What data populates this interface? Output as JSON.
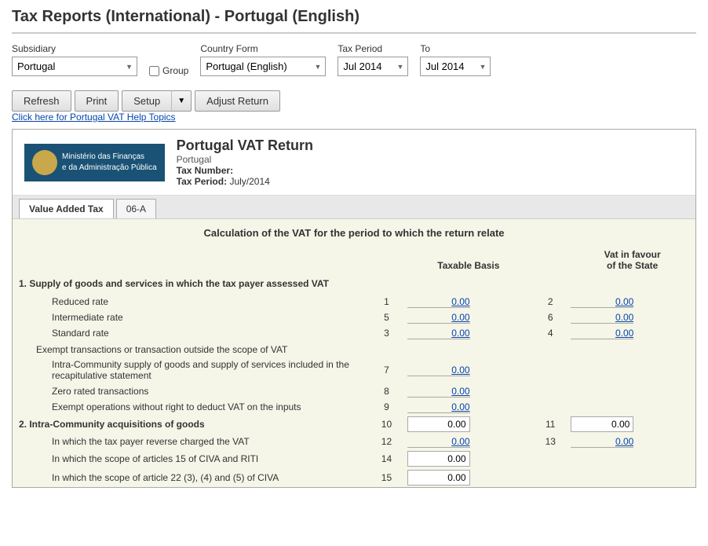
{
  "page": {
    "title": "Tax Reports (International) - Portugal (English)"
  },
  "toolbar": {
    "subsidiary_label": "Subsidiary",
    "subsidiary_value": "Portugal",
    "group_label": "Group",
    "country_form_label": "Country Form",
    "country_form_value": "Portugal (English)",
    "tax_period_label": "Tax Period",
    "tax_period_value": "Jul 2014",
    "to_label": "To",
    "to_value": "Jul 2014",
    "refresh_label": "Refresh",
    "print_label": "Print",
    "setup_label": "Setup",
    "setup_arrow": "▼",
    "adjust_return_label": "Adjust Return"
  },
  "help_link": "Click here for Portugal VAT Help Topics",
  "report": {
    "ministry_line1": "Ministério das Finanças",
    "ministry_line2": "e da Administração Pública",
    "vat_title": "Portugal VAT Return",
    "subtitle": "Portugal",
    "tax_number_label": "Tax Number:",
    "tax_period_label": "Tax Period:",
    "tax_period_value": "July/2014"
  },
  "tabs": [
    {
      "label": "Value Added Tax",
      "active": true
    },
    {
      "label": "06-A",
      "active": false
    }
  ],
  "section": {
    "heading": "Calculation of the VAT for the period to which the return relate",
    "col_taxable_basis": "Taxable Basis",
    "col_vat_favour": "Vat in favour",
    "col_vat_favour2": "of the State",
    "rows": [
      {
        "type": "section-header",
        "label": "1.  Supply of goods and services in which the tax payer assessed VAT",
        "label_bold": true,
        "vat_label": true
      },
      {
        "type": "data-row",
        "label": "Reduced rate",
        "indent": "indent2",
        "num1": "1",
        "val1": "0.00",
        "val1_link": true,
        "num2": "2",
        "val2": "0.00",
        "val2_link": true
      },
      {
        "type": "data-row",
        "label": "Intermediate rate",
        "indent": "indent2",
        "num1": "5",
        "val1": "0.00",
        "val1_link": true,
        "num2": "6",
        "val2": "0.00",
        "val2_link": true
      },
      {
        "type": "data-row",
        "label": "Standard rate",
        "indent": "indent2",
        "num1": "3",
        "val1": "0.00",
        "val1_link": true,
        "num2": "4",
        "val2": "0.00",
        "val2_link": true
      },
      {
        "type": "sub-header",
        "label": "Exempt transactions or transaction outside the scope of VAT",
        "indent": "indent"
      },
      {
        "type": "data-row",
        "label": "Intra-Community supply of goods and supply of services included in the recapitulative statement",
        "indent": "indent2",
        "num1": "7",
        "val1": "0.00",
        "val1_link": true,
        "num2": "",
        "val2": ""
      },
      {
        "type": "data-row",
        "label": "Zero rated transactions",
        "indent": "indent2",
        "num1": "8",
        "val1": "0.00",
        "val1_link": true,
        "num2": "",
        "val2": ""
      },
      {
        "type": "data-row",
        "label": "Exempt operations without right to deduct VAT on the inputs",
        "indent": "indent2",
        "num1": "9",
        "val1": "0.00",
        "val1_link": true,
        "num2": "",
        "val2": ""
      },
      {
        "type": "data-row",
        "label": "2.  Intra-Community acquisitions of goods",
        "indent": "row-bold",
        "num1": "10",
        "val1": "0.00",
        "val1_link": false,
        "num2": "11",
        "val2": "0.00",
        "val2_link": false
      },
      {
        "type": "data-row",
        "label": "In which the tax payer reverse charged the VAT",
        "indent": "indent2",
        "num1": "12",
        "val1": "0.00",
        "val1_link": true,
        "num2": "13",
        "val2": "0.00",
        "val2_link": true
      },
      {
        "type": "data-row",
        "label": "In which the scope of articles 15 of CIVA and RITI",
        "indent": "indent2",
        "num1": "14",
        "val1": "0.00",
        "val1_link": false,
        "num2": "",
        "val2": ""
      },
      {
        "type": "data-row",
        "label": "In which the scope of article 22 (3), (4) and (5) of CIVA",
        "indent": "indent2",
        "num1": "15",
        "val1": "0.00",
        "val1_link": false,
        "num2": "",
        "val2": ""
      }
    ]
  }
}
